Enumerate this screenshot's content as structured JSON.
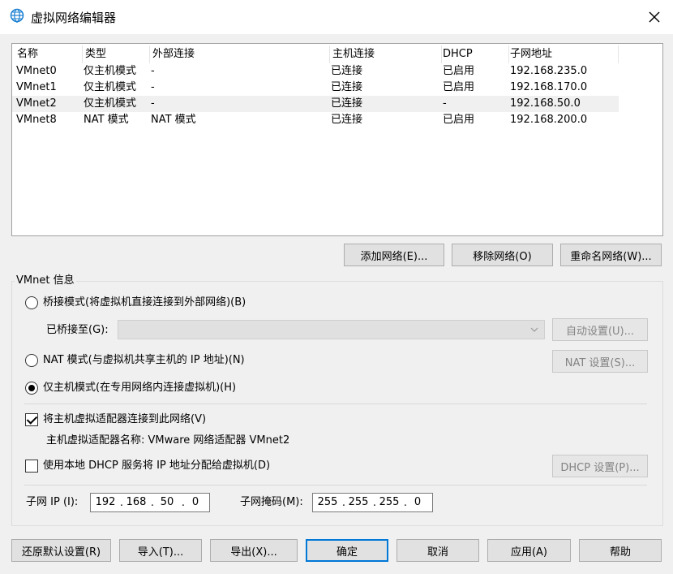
{
  "window": {
    "title": "虚拟网络编辑器",
    "title_icon": "globe-icon",
    "close_icon": "close-icon"
  },
  "table": {
    "columns": [
      "名称",
      "类型",
      "外部连接",
      "主机连接",
      "DHCP",
      "子网地址"
    ],
    "rows": [
      [
        "VMnet0",
        "仅主机模式",
        "-",
        "已连接",
        "已启用",
        "192.168.235.0"
      ],
      [
        "VMnet1",
        "仅主机模式",
        "-",
        "已连接",
        "已启用",
        "192.168.170.0"
      ],
      [
        "VMnet2",
        "仅主机模式",
        "-",
        "已连接",
        "-",
        "192.168.50.0"
      ],
      [
        "VMnet8",
        "NAT 模式",
        "NAT 模式",
        "已连接",
        "已启用",
        "192.168.200.0"
      ]
    ],
    "selected_row": 2
  },
  "network_buttons": {
    "add": "添加网络(E)...",
    "remove": "移除网络(O)",
    "rename": "重命名网络(W)..."
  },
  "vmnet_info": {
    "title": "VMnet 信息",
    "bridged_label": "桥接模式(将虚拟机直接连接到外部网络)(B)",
    "bridged_to_label": "已桥接至(G):",
    "bridged_to_value": "",
    "auto_settings": "自动设置(U)...",
    "nat_label": "NAT 模式(与虚拟机共享主机的 IP 地址)(N)",
    "nat_settings": "NAT 设置(S)...",
    "hostonly_label": "仅主机模式(在专用网络内连接虚拟机)(H)",
    "mode_selected": "hostonly",
    "connect_adapter_label": "将主机虚拟适配器连接到此网络(V)",
    "connect_adapter_checked": true,
    "adapter_name_text": "主机虚拟适配器名称: VMware 网络适配器 VMnet2",
    "dhcp_label": "使用本地 DHCP 服务将 IP 地址分配给虚拟机(D)",
    "dhcp_checked": false,
    "dhcp_settings": "DHCP 设置(P)...",
    "subnet_ip_label": "子网 IP (I):",
    "subnet_ip": [
      "192",
      "168",
      "50",
      "0"
    ],
    "subnet_mask_label": "子网掩码(M):",
    "subnet_mask": [
      "255",
      "255",
      "255",
      "0"
    ]
  },
  "footer": {
    "restore": "还原默认设置(R)",
    "import": "导入(T)...",
    "export": "导出(X)...",
    "ok": "确定",
    "cancel": "取消",
    "apply": "应用(A)",
    "help": "帮助"
  },
  "colors": {
    "accent": "#0078d7",
    "globe_blue": "#1a7fd1",
    "disabled_text": "#838383"
  }
}
